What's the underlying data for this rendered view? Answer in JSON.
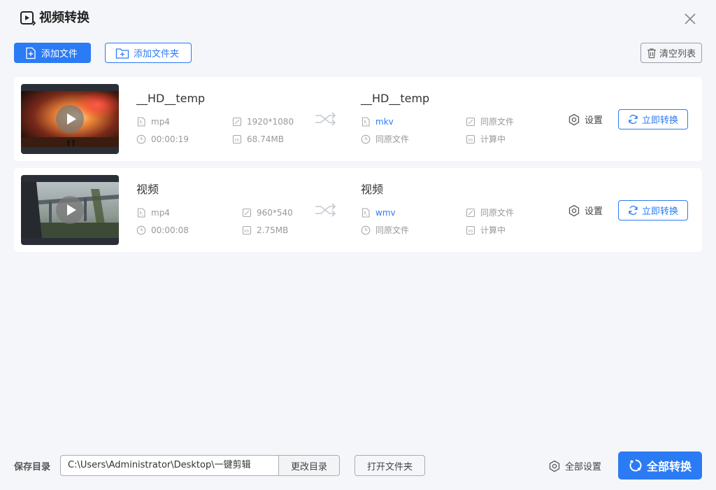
{
  "app": {
    "title": "视频转换",
    "icon": "video-convert-icon",
    "accent_color": "#2b7bf5"
  },
  "toolbar": {
    "add_file_label": "添加文件",
    "add_folder_label": "添加文件夹",
    "clear_list_label": "清空列表"
  },
  "files": [
    {
      "source": {
        "name": "__HD__temp",
        "format": "mp4",
        "resolution": "1920*1080",
        "duration": "00:00:19",
        "size": "68.74MB"
      },
      "target": {
        "name": "__HD__temp",
        "format": "mkv",
        "resolution": "同原文件",
        "duration": "同原文件",
        "size": "计算中"
      },
      "settings_label": "设置",
      "convert_label": "立即转换"
    },
    {
      "source": {
        "name": "视频",
        "format": "mp4",
        "resolution": "960*540",
        "duration": "00:00:08",
        "size": "2.75MB"
      },
      "target": {
        "name": "视频",
        "format": "wmv",
        "resolution": "同原文件",
        "duration": "同原文件",
        "size": "计算中"
      },
      "settings_label": "设置",
      "convert_label": "立即转换"
    }
  ],
  "footer": {
    "save_dir_label": "保存目录",
    "save_path": "C:\\Users\\Administrator\\Desktop\\一键剪辑",
    "change_dir_label": "更改目录",
    "open_folder_label": "打开文件夹",
    "all_settings_label": "全部设置",
    "convert_all_label": "全部转换"
  }
}
